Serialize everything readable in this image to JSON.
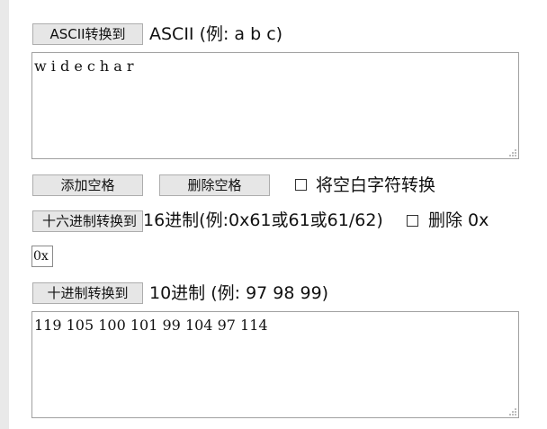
{
  "ascii_section": {
    "button_label": "ASCII转换到",
    "label": "ASCII (例: a b c)",
    "text_value": "w i d e c h a r"
  },
  "space_controls": {
    "add_spaces_label": "添加空格",
    "remove_spaces_label": "删除空格",
    "convert_whitespace_label": "将空白字符转换",
    "convert_whitespace_checked": false
  },
  "hex_section": {
    "button_label": "十六进制转换到",
    "label": "16进制(例:0x61或61或61/62)",
    "remove_prefix_label": "删除 0x",
    "remove_prefix_checked": false,
    "prefix_value": "0x"
  },
  "decimal_section": {
    "button_label": "十进制转换到",
    "label": "10进制 (例: 97 98 99)",
    "text_value": "119 105 100 101 99 104 97 114"
  }
}
